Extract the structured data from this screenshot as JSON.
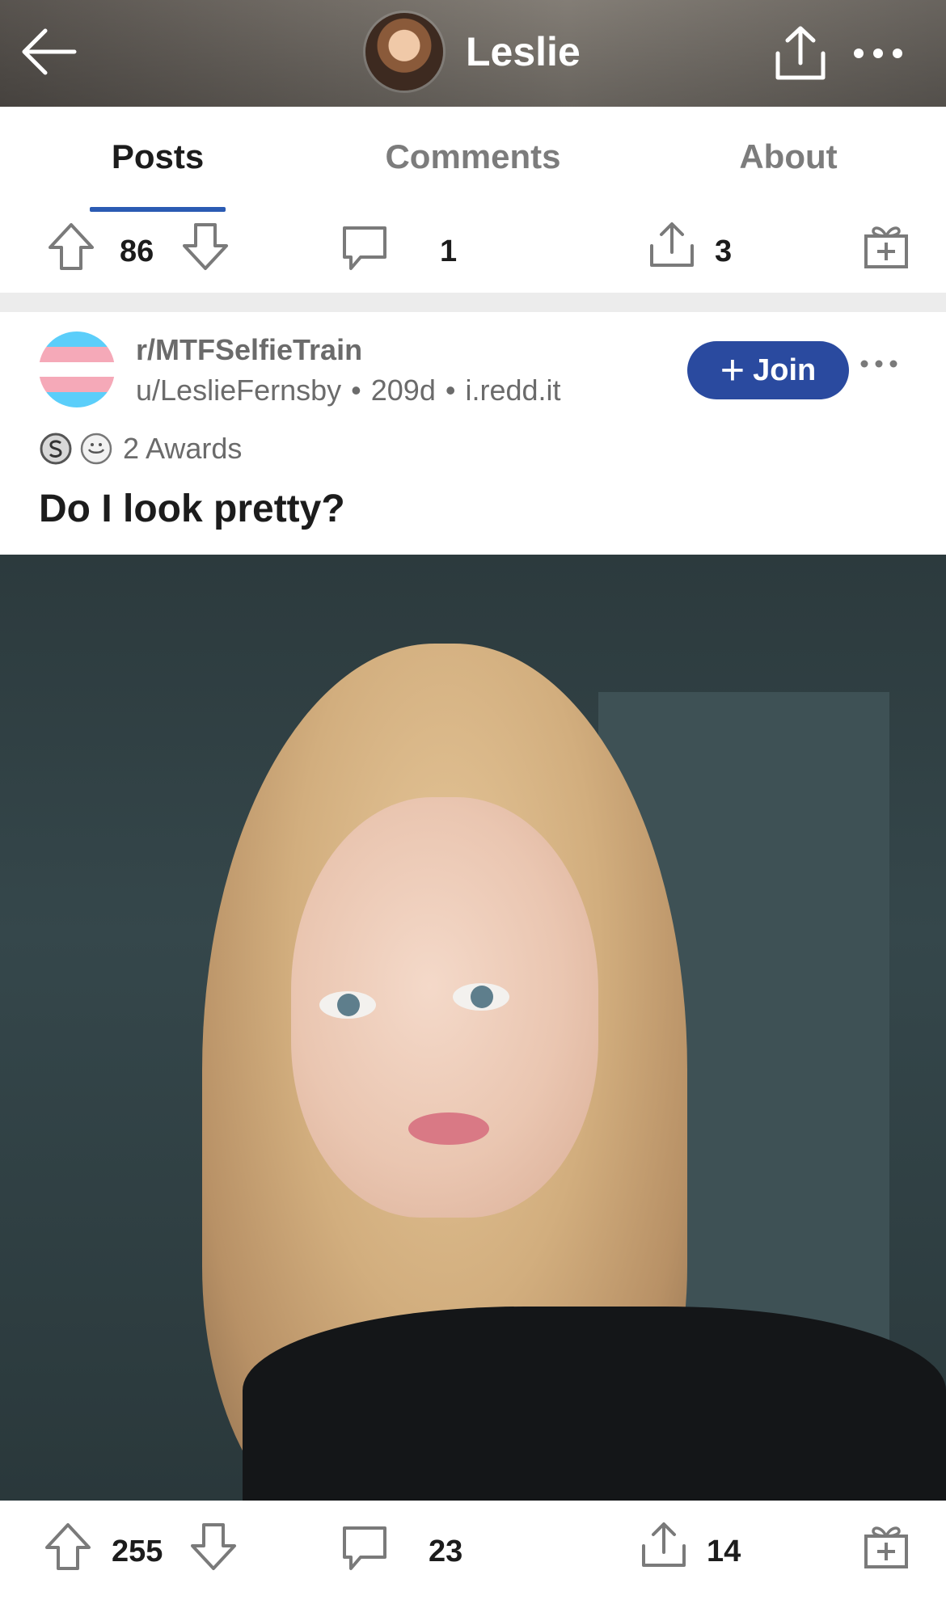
{
  "header": {
    "title": "Leslie",
    "back_icon": "back-arrow-icon",
    "share_icon": "share-icon",
    "more_icon": "more-horizontal-icon"
  },
  "tabs": [
    {
      "label": "Posts",
      "active": true
    },
    {
      "label": "Comments",
      "active": false
    },
    {
      "label": "About",
      "active": false
    }
  ],
  "accent_color": "#2b5bb3",
  "top_action_bar": {
    "score": "86",
    "comments": "1",
    "shares": "3"
  },
  "post": {
    "subreddit": "r/MTFSelfieTrain",
    "author": "u/LeslieFernsby",
    "age": "209d",
    "domain": "i.redd.it",
    "join_label": "Join",
    "awards_label": "2 Awards",
    "title": "Do I look pretty?",
    "subreddit_icon_colors": [
      "#5BCEFA",
      "#F5A9B8",
      "#FFFFFF",
      "#F5A9B8",
      "#5BCEFA"
    ],
    "join_color": "#2a4a9f"
  },
  "bottom_action_bar": {
    "score": "255",
    "comments": "23",
    "shares": "14"
  }
}
